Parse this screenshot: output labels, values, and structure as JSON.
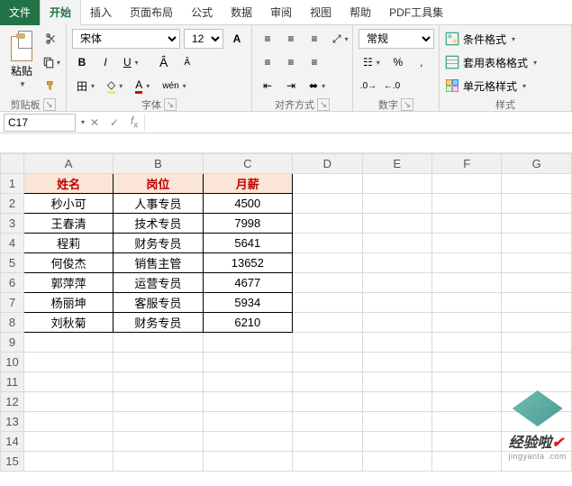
{
  "tabs": {
    "file": "文件",
    "home": "开始",
    "insert": "插入",
    "pagelayout": "页面布局",
    "formulas": "公式",
    "data": "数据",
    "review": "审阅",
    "view": "视图",
    "help": "帮助",
    "pdf": "PDF工具集"
  },
  "clipboard": {
    "paste": "粘贴",
    "group": "剪贴板"
  },
  "font": {
    "name": "宋体",
    "size": "12",
    "bold": "B",
    "italic": "I",
    "underline": "U",
    "pinyin": "wén",
    "group": "字体"
  },
  "align": {
    "group": "对齐方式"
  },
  "number": {
    "format": "常规",
    "percent": "%",
    "group": "数字"
  },
  "styles": {
    "cond": "条件格式",
    "table": "套用表格格式",
    "cell": "单元格样式",
    "group": "样式"
  },
  "namebox": "C17",
  "columns": [
    "A",
    "B",
    "C",
    "D",
    "E",
    "F",
    "G"
  ],
  "rows": [
    "1",
    "2",
    "3",
    "4",
    "5",
    "6",
    "7",
    "8",
    "9",
    "10",
    "11",
    "12",
    "13",
    "14",
    "15"
  ],
  "chart_data": {
    "type": "table",
    "headers": [
      "姓名",
      "岗位",
      "月薪"
    ],
    "records": [
      {
        "name": "秒小可",
        "pos": "人事专员",
        "salary": "4500"
      },
      {
        "name": "王春清",
        "pos": "技术专员",
        "salary": "7998"
      },
      {
        "name": "程莉",
        "pos": "财务专员",
        "salary": "5641"
      },
      {
        "name": "何俊杰",
        "pos": "销售主管",
        "salary": "13652"
      },
      {
        "name": "郭萍萍",
        "pos": "运营专员",
        "salary": "4677"
      },
      {
        "name": "杨丽坤",
        "pos": "客服专员",
        "salary": "5934"
      },
      {
        "name": "刘秋菊",
        "pos": "财务专员",
        "salary": "6210"
      }
    ]
  },
  "watermark": {
    "brand": "经验啦",
    "sub": "jingyanla .com"
  }
}
